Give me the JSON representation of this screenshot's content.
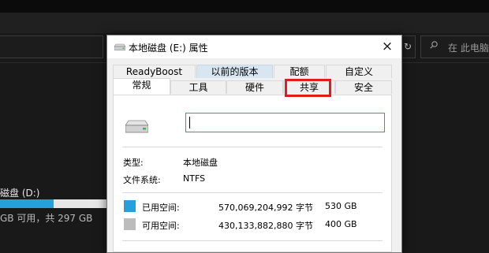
{
  "colors": {
    "used_swatch": "#26a0da",
    "free_swatch": "#bcbcbc",
    "highlight": "#e21b1b",
    "selected_tab": "#d8e6f2"
  },
  "explorer": {
    "search_placeholder": "在 此电脑",
    "refresh_icon": "refresh-icon",
    "drive_d": {
      "label": "磁盘 (D:)",
      "free_text": "GB 可用，共 297 GB",
      "used_fraction": 0.5
    }
  },
  "dialog": {
    "title": "本地磁盘 (E:) 属性",
    "close_glyph": "×",
    "tabs_row1": [
      "ReadyBoost",
      "以前的版本",
      "配额",
      "自定义"
    ],
    "tabs_row2": [
      "常规",
      "工具",
      "硬件",
      "共享",
      "安全"
    ],
    "general": {
      "name_value": "",
      "type_label": "类型:",
      "type_value": "本地磁盘",
      "fs_label": "文件系统:",
      "fs_value": "NTFS",
      "used": {
        "label": "已用空间:",
        "bytes": "570,069,204,992 字节",
        "size": "530 GB"
      },
      "free": {
        "label": "可用空间:",
        "bytes": "430,133,882,880 字节",
        "size": "400 GB"
      }
    }
  }
}
